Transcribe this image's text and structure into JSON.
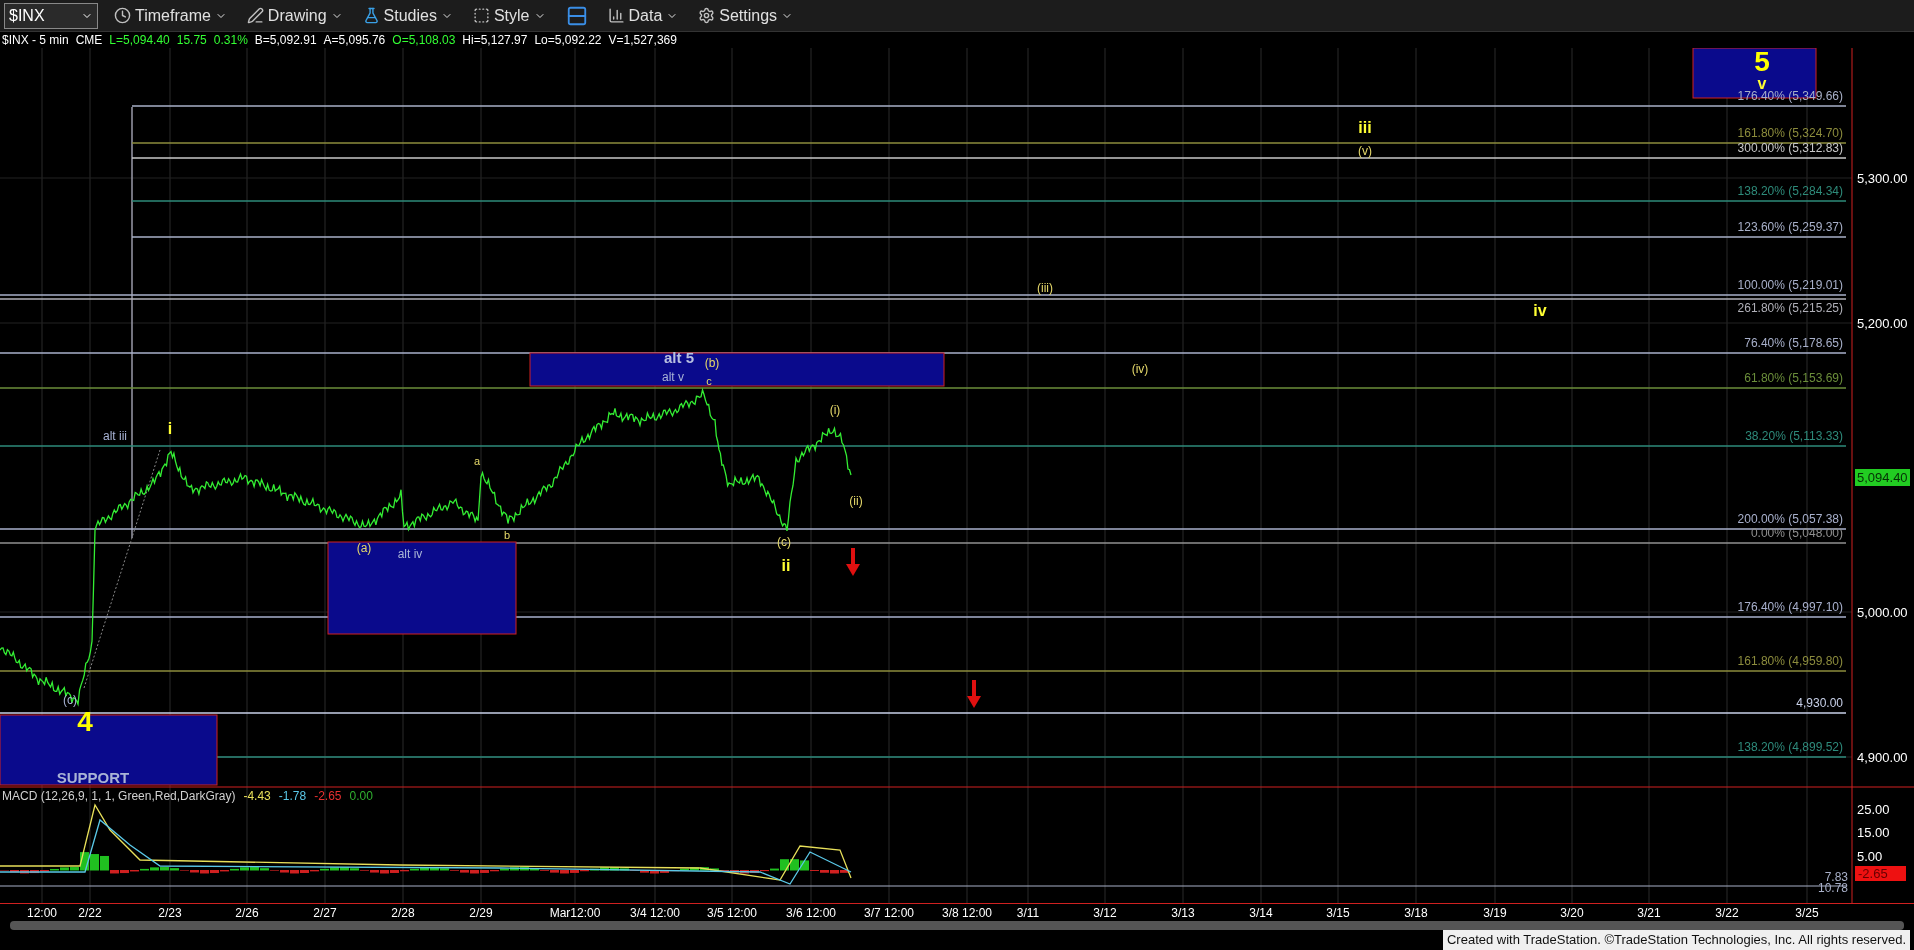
{
  "toolbar": {
    "symbol": "$INX",
    "buttons": [
      {
        "label": "Timeframe",
        "kind": "timeframe"
      },
      {
        "label": "Drawing",
        "kind": "drawing"
      },
      {
        "label": "Studies",
        "kind": "studies"
      },
      {
        "label": "Style",
        "kind": "style"
      },
      {
        "label": "Data",
        "kind": "data"
      },
      {
        "label": "Settings",
        "kind": "settings"
      }
    ]
  },
  "quote": [
    {
      "text": "$INX - 5 min",
      "color": "#ffffff"
    },
    {
      "text": "CME",
      "color": "#ffffff"
    },
    {
      "text": "L=5,094.40",
      "color": "#33ff33"
    },
    {
      "text": "15.75",
      "color": "#33ff33"
    },
    {
      "text": "0.31%",
      "color": "#33ff33"
    },
    {
      "text": "B=5,092.91",
      "color": "#ffffff"
    },
    {
      "text": "A=5,095.76",
      "color": "#ffffff"
    },
    {
      "text": "O=5,108.03",
      "color": "#33ff33"
    },
    {
      "text": "Hi=5,127.97",
      "color": "#ffffff"
    },
    {
      "text": "Lo=5,092.22",
      "color": "#ffffff"
    },
    {
      "text": "V=1,527,369",
      "color": "#ffffff"
    }
  ],
  "fib_levels": [
    {
      "label": "176.40% (5,349.66)",
      "color": "#a8b0c8"
    },
    {
      "label": "161.80% (5,324.70)",
      "color": "#8c8c3c"
    },
    {
      "label": "300.00% (5,312.83)",
      "color": "#c8c8c8"
    },
    {
      "label": "138.20% (5,284.34)",
      "color": "#2e8b7a"
    },
    {
      "label": "123.60% (5,259.37)",
      "color": "#a8b0c9"
    },
    {
      "label": "100.00% (5,219.01)",
      "color": "#a8b0ca"
    },
    {
      "label": "261.80% (5,215.25)",
      "color": "#b0b0b8"
    },
    {
      "label": "76.40% (5,178.65)",
      "color": "#a8b0cb"
    },
    {
      "label": "61.80% (5,153.69)",
      "color": "#6b8e3a"
    },
    {
      "label": "38.20% (5,113.33)",
      "color": "#2e8b7b"
    },
    {
      "label": "200.00% (5,057.38)",
      "color": "#a8b0cc"
    },
    {
      "label": "0.00% (5,048.00)",
      "color": "#909090"
    },
    {
      "label": "176.40% (4,997.10)",
      "color": "#a8b0cd"
    },
    {
      "label": "161.80% (4,959.80)",
      "color": "#8c8c3d"
    },
    {
      "label": "4,930.00",
      "color": "#c8d0e8"
    },
    {
      "label": "138.20% (4,899.52)",
      "color": "#2e8b7c"
    }
  ],
  "annotations": [
    {
      "text": "5",
      "kind": "large"
    },
    {
      "text": "v",
      "kind": "major"
    },
    {
      "text": "iii",
      "kind": "major"
    },
    {
      "text": "(v)",
      "kind": "minor"
    },
    {
      "text": "(iii)",
      "kind": "minor"
    },
    {
      "text": "iv",
      "kind": "major"
    },
    {
      "text": "alt 5",
      "kind": "alt-major"
    },
    {
      "text": "(b)",
      "kind": "minor"
    },
    {
      "text": "(iv)",
      "kind": "minor"
    },
    {
      "text": "alt v",
      "kind": "alt"
    },
    {
      "text": "c",
      "kind": "letter"
    },
    {
      "text": "(i)",
      "kind": "minor"
    },
    {
      "text": "i",
      "kind": "major"
    },
    {
      "text": "alt iii",
      "kind": "alt"
    },
    {
      "text": "a",
      "kind": "letter"
    },
    {
      "text": "(ii)",
      "kind": "minor"
    },
    {
      "text": "b",
      "kind": "letter"
    },
    {
      "text": "(c)",
      "kind": "minor"
    },
    {
      "text": "(a)",
      "kind": "minor"
    },
    {
      "text": "alt iv",
      "kind": "alt"
    },
    {
      "text": "ii",
      "kind": "major"
    },
    {
      "text": "(c)",
      "kind": "alt"
    },
    {
      "text": "4",
      "kind": "large"
    },
    {
      "text": "SUPPORT",
      "kind": "zone-label"
    }
  ],
  "price_axis": {
    "labels": [
      "5,300.00",
      "5,200.00",
      "5,000.00",
      "4,900.00"
    ],
    "last_price": "5,094.40"
  },
  "macd": {
    "title": "MACD (12,26,9, 1, 1, Green,Red,DarkGray)",
    "values": [
      {
        "text": "-4.43",
        "color": "#e8e05a"
      },
      {
        "text": "-1.78",
        "color": "#5ac8e8"
      },
      {
        "text": "-2.65",
        "color": "#e83030"
      },
      {
        "text": "0.00",
        "color": "#30b030"
      }
    ],
    "axis_labels": [
      "25.00",
      "15.00",
      "5.00"
    ],
    "last_value": "-2.65",
    "line_labels": [
      "7.83",
      "10.78"
    ]
  },
  "date_axis": [
    "12:00",
    "2/22",
    "2/23",
    "2/26",
    "2/27",
    "2/28",
    "2/29",
    "Mar12:00",
    "3/4 12:00",
    "3/5 12:00",
    "3/6 12:00",
    "3/7 12:00",
    "3/8 12:00",
    "3/11",
    "3/12",
    "3/13",
    "3/14",
    "3/15",
    "3/18",
    "3/19",
    "3/20",
    "3/21",
    "3/22",
    "3/25"
  ],
  "footer": "Created with TradeStation. ©TradeStation Technologies, Inc. All rights reserved."
}
